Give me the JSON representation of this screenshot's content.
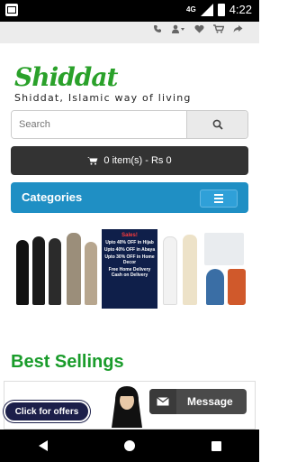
{
  "status_bar": {
    "signal": "4G",
    "time": "4:22"
  },
  "top_icons": [
    "phone-icon",
    "user-icon",
    "heart-icon",
    "cart-icon",
    "share-icon"
  ],
  "brand": {
    "logo_text": "Shiddat",
    "tagline": "Shiddat, Islamic way of living",
    "logo_color": "#2aa12a"
  },
  "search": {
    "placeholder": "Search"
  },
  "cart_bar": {
    "label": "0 item(s) - Rs 0"
  },
  "categories": {
    "label": "Categories",
    "color": "#1f8fc4"
  },
  "banner": {
    "lines": [
      "Sales!",
      "Upto 40% OFF in Hijab",
      "Upto 40% OFF in Abaya",
      "Upto 30% OFF in Home Decor",
      "Free Home Delivery Cash on Delivery"
    ]
  },
  "section": {
    "title": "Best Sellings",
    "color": "#1a9c2b"
  },
  "floating": {
    "offers_label": "Click for offers",
    "message_label": "Message"
  }
}
